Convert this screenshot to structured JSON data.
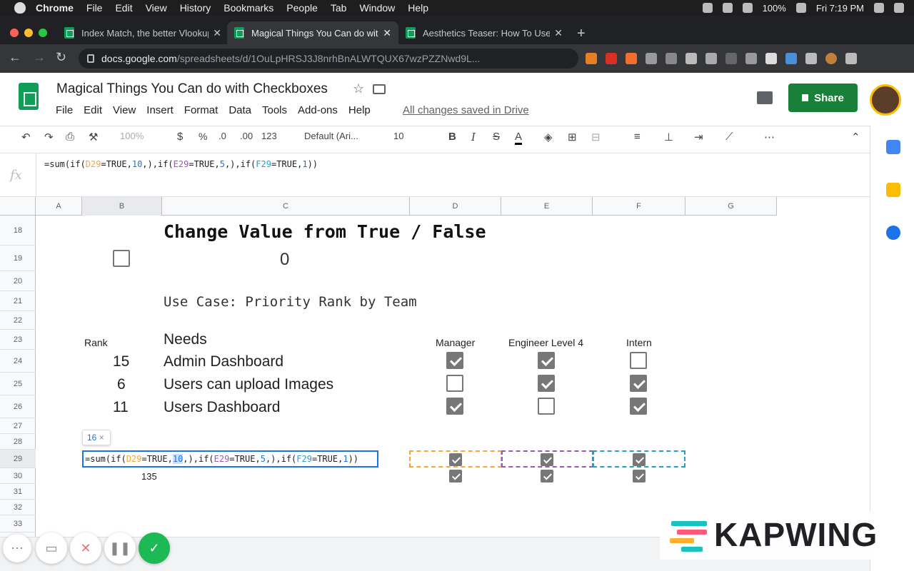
{
  "menubar": {
    "app": "Chrome",
    "items": [
      "File",
      "Edit",
      "View",
      "History",
      "Bookmarks",
      "People",
      "Tab",
      "Window",
      "Help"
    ],
    "battery": "100%",
    "clock": "Fri 7:19 PM"
  },
  "tabs": [
    {
      "title": "Index Match, the better Vlookup"
    },
    {
      "title": "Magical Things You Can do with"
    },
    {
      "title": "Aesthetics Teaser: How To Use"
    }
  ],
  "address": {
    "host": "docs.google.com",
    "path": "/spreadsheets/d/1OuLpHRSJ3J8nrhBnALWTQUX67wzPZZNwd9L..."
  },
  "doc": {
    "title": "Magical Things You Can do with Checkboxes",
    "menus": [
      "File",
      "Edit",
      "View",
      "Insert",
      "Format",
      "Data",
      "Tools",
      "Add-ons",
      "Help"
    ],
    "saved": "All changes saved in Drive",
    "share": "Share"
  },
  "toolbar": {
    "zoom": "100%",
    "currency": "$",
    "percent": "%",
    "dec_less": ".0",
    "dec_more": ".00",
    "format": "123",
    "font": "Default (Ari...",
    "size": "10",
    "bold": "B",
    "italic": "I",
    "strike": "S",
    "textcolor": "A"
  },
  "formula": {
    "p1": "=sum(if(",
    "d": "D29",
    "p2": "=TRUE,",
    "n1": "10",
    "p3": ",),if(",
    "e": "E29",
    "p4": "=TRUE,",
    "n2": "5",
    "p5": ",),if(",
    "f": "F29",
    "p6": "=TRUE,",
    "n3": "1",
    "p7": "))"
  },
  "columns": [
    "A",
    "B",
    "C",
    "D",
    "E",
    "F",
    "G"
  ],
  "rows": [
    "18",
    "19",
    "20",
    "21",
    "22",
    "23",
    "24",
    "25",
    "26",
    "27",
    "28",
    "29",
    "30",
    "31",
    "32",
    "33"
  ],
  "sheet": {
    "heading": "Change Value from True / False",
    "value19": "0",
    "checkbox19": false,
    "usecase": "Use Case: Priority Rank by Team",
    "rank_header": "Rank",
    "needs_header": "Needs",
    "team_headers": [
      "Manager",
      "Engineer Level 4",
      "Intern"
    ],
    "items": [
      {
        "rank": "15",
        "need": "Admin Dashboard",
        "checks": [
          true,
          true,
          false
        ]
      },
      {
        "rank": "6",
        "need": "Users can upload Images",
        "checks": [
          false,
          true,
          true
        ]
      },
      {
        "rank": "11",
        "need": "Users Dashboard",
        "checks": [
          true,
          false,
          true
        ]
      }
    ],
    "row29_checks": [
      true,
      true,
      true
    ],
    "row30_checks": [
      true,
      true,
      true
    ],
    "value30": "135",
    "hint_value": "16",
    "hint_close": "×"
  },
  "kapwing": {
    "word": "KAPWING"
  }
}
